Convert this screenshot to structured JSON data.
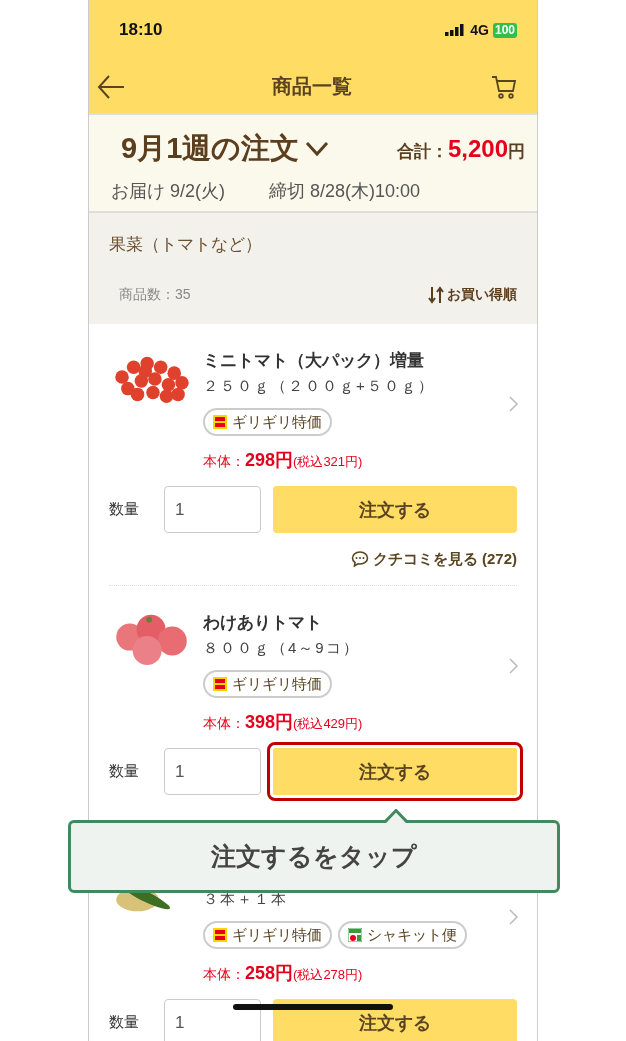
{
  "status_bar": {
    "time": "18:10",
    "network": "4G",
    "battery": "100"
  },
  "nav": {
    "title": "商品一覧"
  },
  "order": {
    "week": "9月1週の注文",
    "total_label": "合計：",
    "total": "5,200",
    "currency": "円",
    "delivery": "お届け 9/2(火)",
    "deadline": "締切 8/28(木)10:00"
  },
  "category": {
    "name": "果菜（トマトなど）",
    "count": "商品数：35",
    "sort": "お買い得順"
  },
  "products": [
    {
      "name": "ミニトマト（大パック）増量",
      "spec": "２５０ｇ（２００ｇ+５０ｇ）",
      "tags": [
        {
          "kind": "deal",
          "label": "ギリギリ特価"
        }
      ],
      "price_label": "本体：",
      "price": "298円",
      "tax": "(税込321円)",
      "qty_label": "数量",
      "qty": "1",
      "order_button": "注文する",
      "highlighted": false,
      "reviews": "クチコミを見る (272)"
    },
    {
      "name": "わけありトマト",
      "spec": "８００ｇ（4～9コ）",
      "tags": [
        {
          "kind": "deal",
          "label": "ギリギリ特価"
        }
      ],
      "price_label": "本体：",
      "price": "398円",
      "tax": "(税込429円)",
      "qty_label": "数量",
      "qty": "1",
      "order_button": "注文する",
      "highlighted": true
    },
    {
      "spec": "３本＋１本",
      "tags": [
        {
          "kind": "deal",
          "label": "ギリギリ特価"
        },
        {
          "kind": "shakit",
          "label": "シャキット便"
        }
      ],
      "price_label": "本体：",
      "price": "258円",
      "tax": "(税込278円)",
      "qty_label": "数量",
      "qty": "1",
      "order_button": "注文する",
      "highlighted": false
    }
  ],
  "tooltip": {
    "text": "注文するをタップ"
  }
}
